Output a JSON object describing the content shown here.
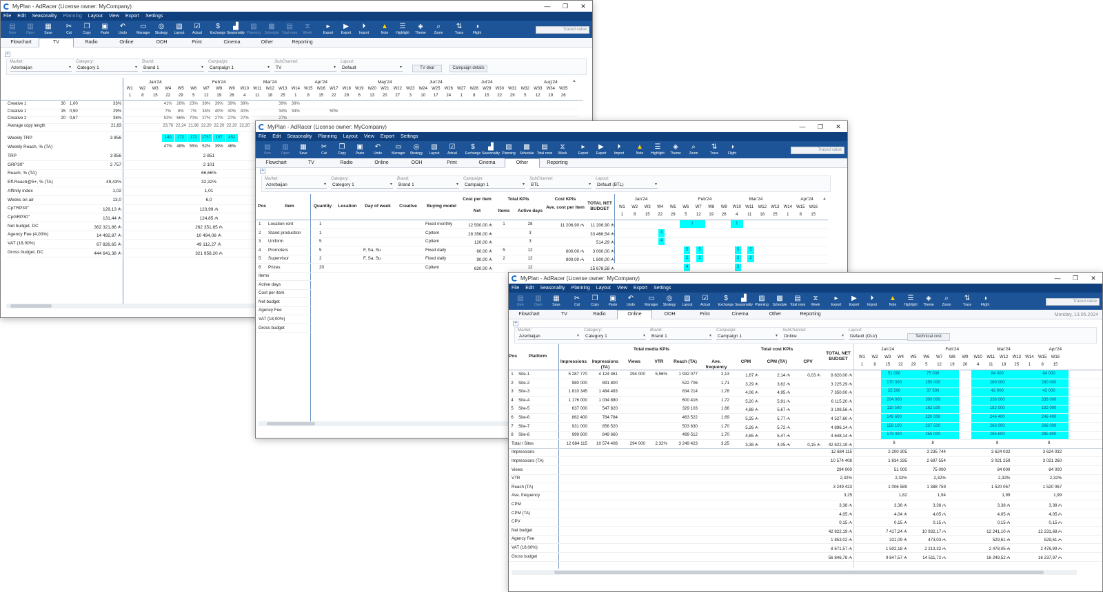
{
  "app": {
    "title": "MyPlan - AdRacer (License owner: MyCompany)"
  },
  "menu": [
    "File",
    "Edit",
    "Seasonality",
    "Planning",
    "Layout",
    "View",
    "Export",
    "Settings"
  ],
  "toolbar": [
    {
      "label": "New",
      "icon": "new-icon",
      "glyph": "▤"
    },
    {
      "label": "Open",
      "icon": "open-icon",
      "glyph": "▥"
    },
    {
      "label": "Save",
      "icon": "save-icon",
      "glyph": "▦"
    },
    {
      "label": "Cut",
      "icon": "cut-icon",
      "glyph": "✂"
    },
    {
      "label": "Copy",
      "icon": "copy-icon",
      "glyph": "❐"
    },
    {
      "label": "Paste",
      "icon": "paste-icon",
      "glyph": "▣"
    },
    {
      "label": "Undo",
      "icon": "undo-icon",
      "glyph": "↶"
    },
    {
      "label": "Manager",
      "icon": "manager-icon",
      "glyph": "▭"
    },
    {
      "label": "Strategy",
      "icon": "strategy-icon",
      "glyph": "◎"
    },
    {
      "label": "Layout",
      "icon": "layout-icon",
      "glyph": "▧"
    },
    {
      "label": "Actual",
      "icon": "actual-icon",
      "glyph": "☑"
    },
    {
      "label": "Exchange",
      "icon": "exchange-icon",
      "glyph": "$"
    },
    {
      "label": "Seasonality",
      "icon": "seasonality-icon",
      "glyph": "▟"
    },
    {
      "label": "Planning",
      "icon": "planning-icon",
      "glyph": "▨"
    },
    {
      "label": "Schedule",
      "icon": "schedule-icon",
      "glyph": "▩"
    },
    {
      "label": "Total rows",
      "icon": "total-rows-icon",
      "glyph": "▤"
    },
    {
      "label": "Week",
      "icon": "week-icon",
      "glyph": "⧖"
    },
    {
      "label": "Export",
      "icon": "export-icon",
      "glyph": "▸"
    },
    {
      "label": "Export",
      "icon": "export2-icon",
      "glyph": "▶"
    },
    {
      "label": "Import",
      "icon": "import-icon",
      "glyph": "⏵"
    },
    {
      "label": "Note",
      "icon": "note-warning-icon",
      "glyph": "▲"
    },
    {
      "label": "Highlight",
      "icon": "highlight-icon",
      "glyph": "☰"
    },
    {
      "label": "Theme",
      "icon": "theme-icon",
      "glyph": "◈"
    },
    {
      "label": "Zoom",
      "icon": "zoom-icon",
      "glyph": "⌕"
    },
    {
      "label": "Trace",
      "icon": "trace-icon",
      "glyph": "⇅"
    },
    {
      "label": "Flight",
      "icon": "flight-icon",
      "glyph": "◑"
    }
  ],
  "traced_placeholder": "Traced value",
  "tabs": [
    "Flowchart",
    "TV",
    "Radio",
    "Online",
    "OOH",
    "Print",
    "Cinema",
    "Other",
    "Reporting"
  ],
  "filter_labels": [
    "Market:",
    "Category:",
    "Brand:",
    "Campaign:",
    "SubChannel:",
    "Layout:"
  ],
  "w1": {
    "filters": [
      "Azerbaijan",
      "Category 1",
      "Brand 1",
      "Campaign 1",
      "TV",
      "Default"
    ],
    "buttons": [
      "TV deal",
      "Campaign details"
    ],
    "months": [
      "Jan'24",
      "Feb'24",
      "Mar'24",
      "Apr'24",
      "May'24",
      "Jun'24",
      "Jul'24",
      "Aug'24"
    ],
    "weeks": [
      "W1",
      "W2",
      "W3",
      "W4",
      "W5",
      "W6",
      "W7",
      "W8",
      "W9",
      "W10",
      "W11",
      "W12",
      "W13",
      "W14",
      "W15",
      "W16",
      "W17",
      "W18",
      "W19",
      "W20",
      "W21",
      "W22",
      "W23",
      "W24",
      "W25",
      "W26",
      "W27",
      "W28",
      "W29",
      "W30",
      "W31",
      "W32",
      "W33",
      "W34",
      "W35"
    ],
    "days": [
      "1",
      "8",
      "15",
      "22",
      "29",
      "5",
      "12",
      "19",
      "26",
      "4",
      "11",
      "18",
      "25",
      "1",
      "8",
      "15",
      "22",
      "29",
      "6",
      "13",
      "20",
      "27",
      "3",
      "10",
      "17",
      "24",
      "1",
      "8",
      "15",
      "22",
      "29",
      "5",
      "12",
      "19",
      "26"
    ],
    "creatives": [
      {
        "name": "Creative 1",
        "a": "30",
        "b": "1,00",
        "c": "33%",
        "w": [
          "41%",
          "26%",
          "23%",
          "39%",
          "39%",
          "39%",
          "39%",
          "",
          "",
          "39%",
          "39%"
        ]
      },
      {
        "name": "Creative 1",
        "a": "15",
        "b": "0,50",
        "c": "29%",
        "w": [
          "7%",
          "8%",
          "7%",
          "34%",
          "40%",
          "40%",
          "40%",
          "",
          "",
          "34%",
          "34%",
          "",
          "",
          "50%"
        ]
      },
      {
        "name": "Creative 2",
        "a": "20",
        "b": "0,67",
        "c": "38%",
        "w": [
          "52%",
          "66%",
          "70%",
          "27%",
          "27%",
          "27%",
          "27%",
          "",
          "",
          "27%"
        ]
      },
      {
        "name": "Average copy length",
        "a": "",
        "b": "",
        "c": "21,63",
        "w": [
          "23,76",
          "22,24",
          "21,96",
          "22,20",
          "22,20",
          "22,20",
          "22,20"
        ]
      }
    ],
    "weekly_trp": {
      "label": "Weekly TRP",
      "total": "3 856",
      "w": [
        "140",
        "172",
        "172",
        "1757",
        "157",
        "452"
      ]
    },
    "weekly_reach": {
      "label": "Weekly Reach, % (TA)",
      "w": [
        "47%",
        "48%",
        "55%",
        "52%",
        "39%",
        "46%"
      ]
    },
    "kpis": [
      {
        "label": "TRP",
        "v1": "3 856",
        "v2": "2 851"
      },
      {
        "label": "GRP30\"",
        "v1": "2 757",
        "v2": "2 101"
      },
      {
        "label": "Reach, % (TA)",
        "v1": "",
        "v2": "66,66%"
      },
      {
        "label": "Eff.Reach@5+, % (TA)",
        "v1": "49,43%",
        "v2": "32,32%"
      },
      {
        "label": "Affinity index",
        "v1": "1,02",
        "v2": "1,01"
      },
      {
        "label": "Weeks on air",
        "v1": "13,0",
        "v2": "6,0"
      },
      {
        "label": "CpTRP30\"",
        "v1": "129,13 ₼",
        "v2": "123,99 ₼"
      },
      {
        "label": "CpGRP30\"",
        "v1": "131,44 ₼",
        "v2": "124,85 ₼"
      },
      {
        "label": "Net budget, DC",
        "v1": "362 321,86 ₼",
        "v2": "262 351,85 ₼"
      },
      {
        "label": "Agency Fee (4,00%)",
        "v1": "14 492,87 ₼",
        "v2": "10 494,08 ₼"
      },
      {
        "label": "VAT (18,00%)",
        "v1": "67 826,65 ₼",
        "v2": "49 112,27 ₼"
      },
      {
        "label": "Gross budget, DC",
        "v1": "444 641,38 ₼",
        "v2": "321 958,20 ₼"
      }
    ]
  },
  "w2": {
    "filters": [
      "Azerbaijan",
      "Category 1",
      "Brand 1",
      "Campaign 1",
      "BTL",
      "Default (BTL)"
    ],
    "headers": {
      "pos": "Pos",
      "item": "Item",
      "quantity": "Quantity",
      "location": "Location",
      "dow": "Day of week",
      "creative": "Creative",
      "buying": "Buying model",
      "cpi": "Cost per item",
      "net": "Net",
      "total_kpis": "Total KPIs",
      "items": "Items",
      "active_days": "Active days",
      "cost_kpis": "Cost KPIs",
      "ave_cost": "Ave. cost per item",
      "total_net": "TOTAL NET BUDGET"
    },
    "months": [
      "Jan'24",
      "Feb'24",
      "Mar'24",
      "Apr'24"
    ],
    "weeks": [
      "W1",
      "W2",
      "W3",
      "W4",
      "W5",
      "W6",
      "W7",
      "W8",
      "W9",
      "W10",
      "W11",
      "W12",
      "W13",
      "W14",
      "W15",
      "W16"
    ],
    "days": [
      "1",
      "8",
      "15",
      "22",
      "29",
      "5",
      "12",
      "19",
      "26",
      "4",
      "11",
      "18",
      "25",
      "1",
      "8",
      "15"
    ],
    "rows": [
      {
        "pos": "1",
        "item": "Location rent",
        "qty": "1",
        "dow": "",
        "buy": "Fixed monthly",
        "cost": "12 500,00 ₼",
        "items": "1",
        "days": "28",
        "ave": "11 206,90 ₼",
        "total": "11 206,90 ₼"
      },
      {
        "pos": "2",
        "item": "Stand production",
        "qty": "1",
        "dow": "",
        "buy": "CpItem",
        "cost": "28 356,00 ₼",
        "items": "",
        "days": "3",
        "ave": "",
        "total": "33 466,54 ₼"
      },
      {
        "pos": "3",
        "item": "Uniform",
        "qty": "5",
        "dow": "",
        "buy": "CpItem",
        "cost": "120,00 ₼",
        "items": "",
        "days": "3",
        "ave": "",
        "total": "514,29 ₼"
      },
      {
        "pos": "4",
        "item": "Promoters",
        "qty": "5",
        "dow": "F, Sa, Su",
        "buy": "Fixed daily",
        "cost": "60,00 ₼",
        "items": "5",
        "days": "12",
        "ave": "600,00 ₼",
        "total": "3 000,00 ₼"
      },
      {
        "pos": "5",
        "item": "Supervisor",
        "qty": "2",
        "dow": "F, Sa, Su",
        "buy": "Fixed daily",
        "cost": "90,00 ₼",
        "items": "2",
        "days": "12",
        "ave": "900,00 ₼",
        "total": "1 800,00 ₼"
      },
      {
        "pos": "6",
        "item": "Prizes",
        "qty": "20",
        "dow": "",
        "buy": "CpItem",
        "cost": "820,00 ₼",
        "items": "",
        "days": "12",
        "ave": "",
        "total": "15 678,58 ₼"
      }
    ],
    "bottom": [
      "Items",
      "Active days",
      "Cost per item",
      "Net budget",
      "Agency Fee",
      "VAT (18,00%)",
      "Gross budget"
    ],
    "cells": [
      "1",
      "1",
      "3",
      "4",
      "5",
      "5",
      "5",
      "5",
      "2",
      "2",
      "2",
      "2",
      "4",
      "2"
    ]
  },
  "w3": {
    "date": "Monday, 13.05.2024",
    "filters": [
      "Azerbaijan",
      "Category 1",
      "Brand 1",
      "Campaign 1",
      "Online",
      "Default (OLV)"
    ],
    "button": "Technical cost",
    "headers": {
      "pos": "Pos",
      "platform": "Platform",
      "impressions": "Impressions",
      "impressions_ta": "Impressions (TA)",
      "total_media": "Total media KPIs",
      "views": "Views",
      "vtr": "VTR",
      "reach": "Reach (TA)",
      "freq": "Ave. frequency",
      "total_cost": "Total cost KPIs",
      "cpm": "CPM",
      "cpm_ta": "CPM (TA)",
      "cpv": "CPV",
      "total_net": "TOTAL NET BUDGET"
    },
    "months": [
      "Jan'24",
      "Feb'24",
      "Mar'24",
      "Apr'24"
    ],
    "weeks": [
      "W1",
      "W2",
      "W3",
      "W4",
      "W5",
      "W6",
      "W7",
      "W8",
      "W9",
      "W10",
      "W11",
      "W12",
      "W13",
      "W14",
      "W15",
      "W16"
    ],
    "days": [
      "1",
      "8",
      "15",
      "22",
      "29",
      "5",
      "12",
      "19",
      "26",
      "4",
      "11",
      "18",
      "25",
      "1",
      "8",
      "15"
    ],
    "rows": [
      {
        "pos": "1",
        "name": "Site-1",
        "imp": "5 287 770",
        "impta": "4 124 461",
        "views": "294 000",
        "vtr": "5,56%",
        "reach": "1 932 077",
        "freq": "2,13",
        "cpm": "1,67 ₼",
        "cpmta": "2,14 ₼",
        "cpv": "0,03 ₼",
        "total": "8 820,00 ₼",
        "a": "51 000",
        "b": "75 000",
        "c": "84 000",
        "d": "84 000"
      },
      {
        "pos": "2",
        "name": "Site-2",
        "imp": "980 000",
        "impta": "891 800",
        "views": "",
        "vtr": "",
        "reach": "522 706",
        "freq": "1,71",
        "cpm": "3,29 ₼",
        "cpmta": "3,62 ₼",
        "cpv": "",
        "total": "3 225,29 ₼",
        "a": "170 000",
        "b": "250 000",
        "c": "280 000",
        "d": "280 000"
      },
      {
        "pos": "3",
        "name": "Site-3",
        "imp": "1 810 345",
        "impta": "1 484 483",
        "views": "",
        "vtr": "",
        "reach": "834 214",
        "freq": "1,78",
        "cpm": "4,06 ₼",
        "cpmta": "4,95 ₼",
        "cpv": "",
        "total": "7 350,00 ₼",
        "a": "25 500",
        "b": "37 500",
        "c": "42 000",
        "d": "42 000"
      },
      {
        "pos": "4",
        "name": "Site-4",
        "imp": "1 176 000",
        "impta": "1 034 880",
        "views": "",
        "vtr": "",
        "reach": "600 416",
        "freq": "1,72",
        "cpm": "5,20 ₼",
        "cpmta": "5,91 ₼",
        "cpv": "",
        "total": "6 115,20 ₼",
        "a": "204 000",
        "b": "300 000",
        "c": "336 000",
        "d": "336 000"
      },
      {
        "pos": "5",
        "name": "Site-5",
        "imp": "637 000",
        "impta": "547 820",
        "views": "",
        "vtr": "",
        "reach": "329 103",
        "freq": "1,66",
        "cpm": "4,88 ₼",
        "cpmta": "5,67 ₼",
        "cpv": "",
        "total": "3 108,56 ₼",
        "a": "110 500",
        "b": "162 500",
        "c": "182 000",
        "d": "182 000"
      },
      {
        "pos": "6",
        "name": "Site-6",
        "imp": "862 400",
        "impta": "784 784",
        "views": "",
        "vtr": "",
        "reach": "463 522",
        "freq": "1,69",
        "cpm": "5,25 ₼",
        "cpmta": "5,77 ₼",
        "cpv": "",
        "total": "4 527,60 ₼",
        "a": "149 600",
        "b": "220 000",
        "c": "246 400",
        "d": "246 400"
      },
      {
        "pos": "7",
        "name": "Site-7",
        "imp": "931 000",
        "impta": "856 520",
        "views": "",
        "vtr": "",
        "reach": "503 630",
        "freq": "1,70",
        "cpm": "5,26 ₼",
        "cpmta": "5,72 ₼",
        "cpv": "",
        "total": "4 896,14 ₼",
        "a": "158 100",
        "b": "237 500",
        "c": "266 000",
        "d": "266 000"
      },
      {
        "pos": "8",
        "name": "Site-8",
        "imp": "999 600",
        "impta": "849 660",
        "views": "",
        "vtr": "",
        "reach": "499 512",
        "freq": "1,70",
        "cpm": "4,65 ₼",
        "cpmta": "5,47 ₼",
        "cpv": "",
        "total": "4 648,14 ₼",
        "a": "173 400",
        "b": "255 000",
        "c": "285 600",
        "d": "285 600"
      }
    ],
    "total_row": {
      "label": "Total / Sites",
      "imp": "12 684 115",
      "impta": "10 574 408",
      "views": "294 000",
      "vtr": "2,32%",
      "reach": "3 249 423",
      "freq": "3,25",
      "cpm": "3,38 ₼",
      "cpmta": "4,05 ₼",
      "cpv": "0,15 ₼",
      "total": "42 822,19 ₼",
      "a": "8",
      "b": "8",
      "c": "8",
      "d": "8"
    },
    "summary": [
      {
        "label": "Impressions",
        "t": "12 684 115",
        "a": "2 200 305",
        "b": "3 235 744",
        "c": "3 624 032",
        "d": "3 624 032"
      },
      {
        "label": "Impressions (TA)",
        "t": "10 574 408",
        "a": "1 834 335",
        "b": "2 697 554",
        "c": "3 021 259",
        "d": "3 021 260"
      },
      {
        "label": "Views",
        "t": "294 000",
        "a": "51 000",
        "b": "75 000",
        "c": "84 000",
        "d": "84 000"
      },
      {
        "label": "VTR",
        "t": "2,32%",
        "a": "2,32%",
        "b": "2,32%",
        "c": "2,32%",
        "d": "2,32%"
      },
      {
        "label": "Reach (TA)",
        "t": "3 249 423",
        "a": "1 006 589",
        "b": "1 388 759",
        "c": "1 520 067",
        "d": "1 520 067"
      },
      {
        "label": "Ave. frequency",
        "t": "3,25",
        "a": "1,82",
        "b": "1,94",
        "c": "1,99",
        "d": "1,99"
      },
      {
        "label": "CPM",
        "t": "3,38 ₼",
        "a": "3,38 ₼",
        "b": "3,38 ₼",
        "c": "3,38 ₼",
        "d": "3,38 ₼"
      },
      {
        "label": "CPM (TA)",
        "t": "4,05 ₼",
        "a": "4,04 ₼",
        "b": "4,05 ₼",
        "c": "4,05 ₼",
        "d": "4,05 ₼"
      },
      {
        "label": "CPV",
        "t": "0,15 ₼",
        "a": "0,15 ₼",
        "b": "0,15 ₼",
        "c": "0,15 ₼",
        "d": "0,15 ₼"
      },
      {
        "label": "Net budget",
        "t": "42 822,19 ₼",
        "a": "7 417,24 ₼",
        "b": "10 932,17 ₼",
        "c": "12 241,10 ₼",
        "d": "12 231,68 ₼"
      },
      {
        "label": "Agency Fee",
        "t": "1 853,02 ₼",
        "a": "321,09 ₼",
        "b": "473,03 ₼",
        "c": "529,61 ₼",
        "d": "529,61 ₼"
      },
      {
        "label": "VAT (18,00%)",
        "t": "8 671,57 ₼",
        "a": "1 502,18 ₼",
        "b": "2 213,32 ₼",
        "c": "2 478,05 ₼",
        "d": "2 476,99 ₼"
      },
      {
        "label": "Gross budget",
        "t": "56 846,78 ₼",
        "a": "9 847,57 ₼",
        "b": "14 511,72 ₼",
        "c": "16 249,52 ₼",
        "d": "16 237,97 ₼"
      }
    ]
  }
}
